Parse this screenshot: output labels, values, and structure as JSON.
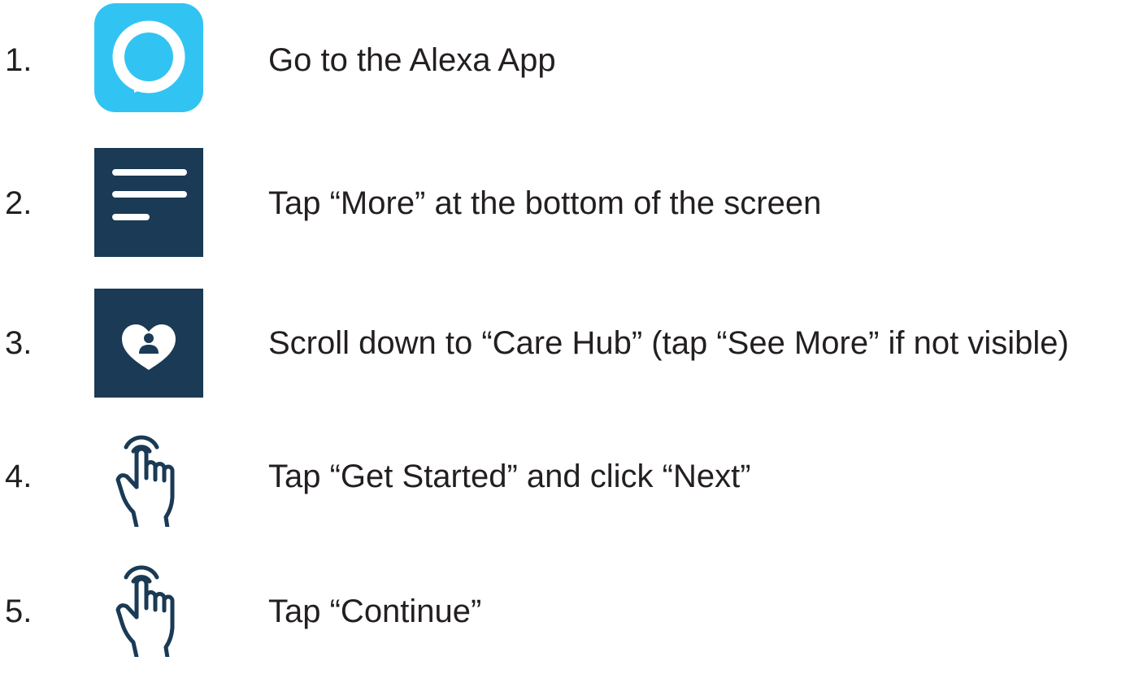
{
  "steps": [
    {
      "number": "1.",
      "icon": "alexa-app-icon",
      "text": "Go to the Alexa App"
    },
    {
      "number": "2.",
      "icon": "more-menu-icon",
      "text": "Tap “More” at the bottom of the screen"
    },
    {
      "number": "3.",
      "icon": "care-hub-heart-icon",
      "text": "Scroll down to “Care Hub” (tap “See More” if not visible)"
    },
    {
      "number": "4.",
      "icon": "tap-hand-icon",
      "text": "Tap “Get Started” and click “Next”"
    },
    {
      "number": "5.",
      "icon": "tap-hand-icon",
      "text": "Tap “Continue”"
    }
  ],
  "colors": {
    "alexa_blue": "#31c4f3",
    "navy": "#1a3a55",
    "text": "#231f20"
  }
}
